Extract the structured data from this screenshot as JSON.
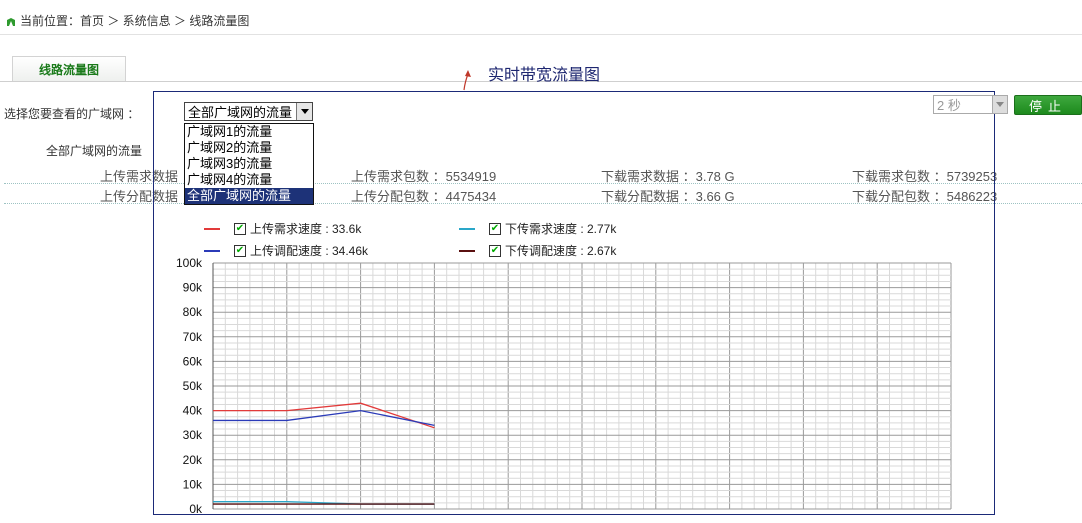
{
  "breadcrumb": {
    "text": "当前位置：首页 ＞ 系统信息 ＞ 线路流量图"
  },
  "tab": {
    "label": "线路流量图"
  },
  "select_label": "选择您要查看的广域网 ：",
  "region_label": "全部广域网的流量",
  "panel_title": "实时带宽流量图",
  "dropdown": {
    "selected": "全部广域网的流量",
    "options": [
      "广域网1的流量",
      "广域网2的流量",
      "广域网3的流量",
      "广域网4的流量",
      "全部广域网的流量"
    ]
  },
  "interval": {
    "value": "2 秒"
  },
  "stop_button": {
    "label": "停止"
  },
  "stats": {
    "row1": [
      "上传需求数据",
      "上传需求包数 ：5534919",
      "下载需求数据 ：3.78 G",
      "下载需求包数 ：5739253"
    ],
    "row2": [
      "上传分配数据",
      "上传分配包数 ：4475434",
      "下载分配数据 ：3.66 G",
      "下载分配包数 ：5486223"
    ]
  },
  "legend": [
    {
      "label": "上传需求速度 : 33.6k",
      "color": "#e23a3a"
    },
    {
      "label": "下传需求速度 : 2.77k",
      "color": "#2aa7c9"
    },
    {
      "label": "上传调配速度 : 34.46k",
      "color": "#2b3bb8"
    },
    {
      "label": "下传调配速度 : 2.67k",
      "color": "#5a1010"
    }
  ],
  "chart_data": {
    "type": "line",
    "ylim": [
      0,
      100
    ],
    "yticks": [
      "0k",
      "10k",
      "20k",
      "30k",
      "40k",
      "50k",
      "60k",
      "70k",
      "80k",
      "90k",
      "100k"
    ],
    "x": [
      0,
      1,
      2,
      3
    ],
    "series": [
      {
        "name": "上传需求速度",
        "color": "#e23a3a",
        "values": [
          40,
          40,
          43,
          33
        ]
      },
      {
        "name": "上传调配速度",
        "color": "#2b3bb8",
        "values": [
          36,
          36,
          40,
          34
        ]
      },
      {
        "name": "下传需求速度",
        "color": "#2aa7c9",
        "values": [
          3,
          3,
          2,
          2
        ]
      },
      {
        "name": "下传调配速度",
        "color": "#5a1010",
        "values": [
          2,
          2,
          2,
          2
        ]
      }
    ]
  }
}
